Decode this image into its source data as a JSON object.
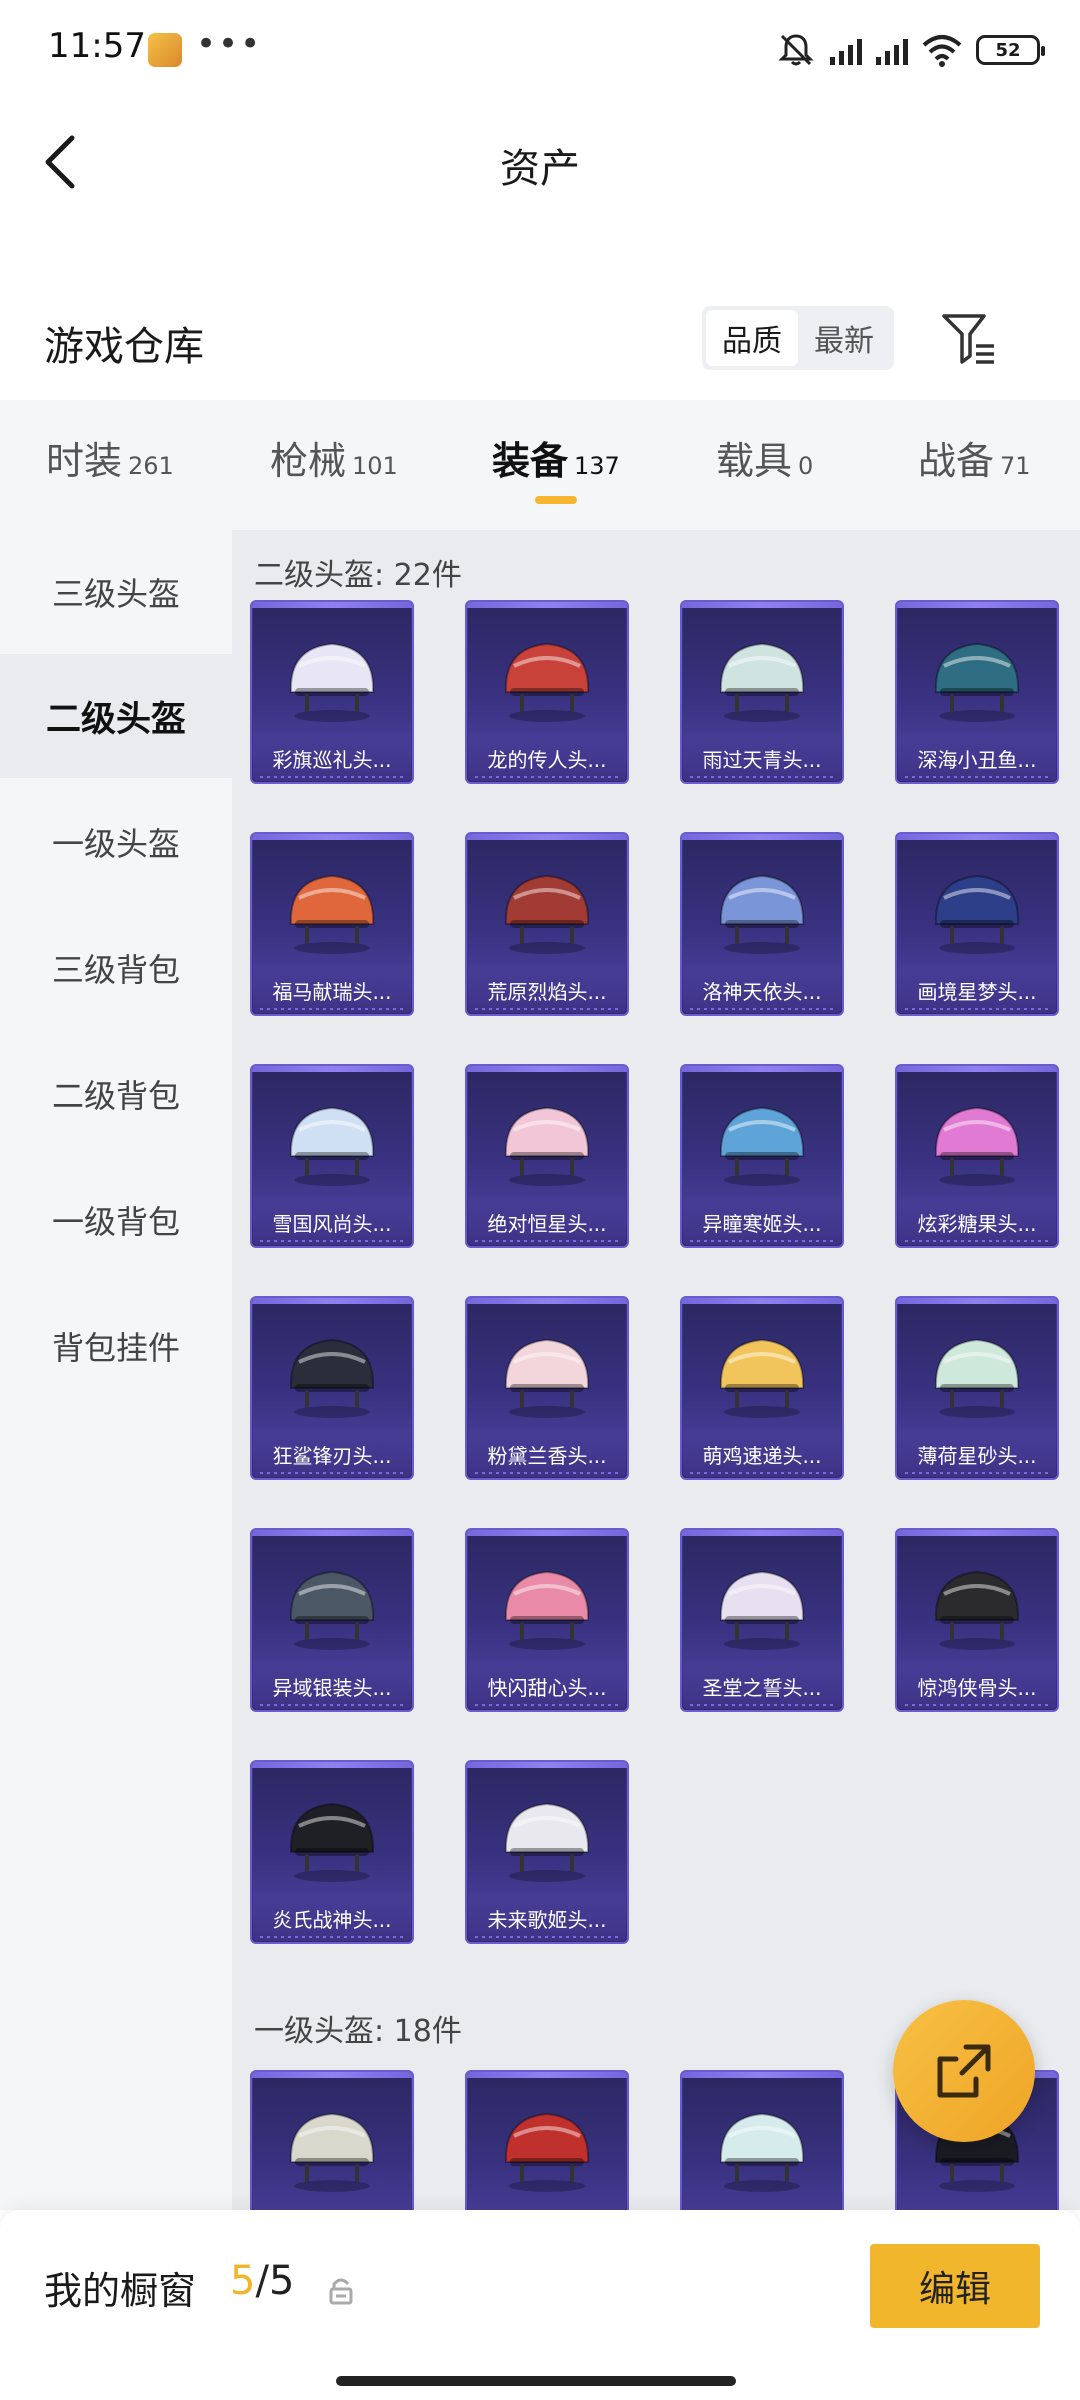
{
  "status_bar": {
    "time": "11:57",
    "dots": "•••",
    "battery": "52"
  },
  "header": {
    "title": "资产"
  },
  "warehouse": {
    "title": "游戏仓库",
    "sort_options": [
      "品质",
      "最新"
    ]
  },
  "tabs": [
    {
      "label": "时装",
      "count": "261"
    },
    {
      "label": "枪械",
      "count": "101"
    },
    {
      "label": "装备",
      "count": "137"
    },
    {
      "label": "载具",
      "count": "0"
    },
    {
      "label": "战备",
      "count": "71"
    }
  ],
  "sidebar": {
    "items": [
      "三级头盔",
      "二级头盔",
      "一级头盔",
      "三级背包",
      "二级背包",
      "一级背包",
      "背包挂件"
    ]
  },
  "sections": [
    {
      "title": "二级头盔: 22件",
      "items": [
        {
          "name": "彩旗巡礼头..."
        },
        {
          "name": "龙的传人头..."
        },
        {
          "name": "雨过天青头..."
        },
        {
          "name": "深海小丑鱼..."
        },
        {
          "name": "福马献瑞头..."
        },
        {
          "name": "荒原烈焰头..."
        },
        {
          "name": "洛神天依头..."
        },
        {
          "name": "画境星梦头..."
        },
        {
          "name": "雪国风尚头..."
        },
        {
          "name": "绝对恒星头..."
        },
        {
          "name": "异瞳寒姬头..."
        },
        {
          "name": "炫彩糖果头..."
        },
        {
          "name": "狂鲨锋刃头..."
        },
        {
          "name": "粉黛兰香头..."
        },
        {
          "name": "萌鸡速递头..."
        },
        {
          "name": "薄荷星砂头..."
        },
        {
          "name": "异域银装头..."
        },
        {
          "name": "快闪甜心头..."
        },
        {
          "name": "圣堂之誓头..."
        },
        {
          "name": "惊鸿侠骨头..."
        },
        {
          "name": "炎氏战神头..."
        },
        {
          "name": "未来歌姬头..."
        }
      ]
    },
    {
      "title": "一级头盔: 18件"
    }
  ],
  "bottom_bar": {
    "label": "我的橱窗",
    "current": "5",
    "separator": "/",
    "total": "5",
    "edit_label": "编辑"
  },
  "helmet_colors": [
    "#e8e6f4",
    "#c8423a",
    "#cfe3e0",
    "#2e6d82",
    "#e0673c",
    "#a23b34",
    "#7a95d8",
    "#2c3f88",
    "#cfe0f4",
    "#f2c6d6",
    "#5fa4d8",
    "#e07ad2",
    "#2a2d3a",
    "#f2d6dc",
    "#f2c55c",
    "#cfe8dc",
    "#4c5766",
    "#e88aa8",
    "#e6e0f0",
    "#2b2b2e",
    "#1f1f26",
    "#e8e8ee",
    "#d8d8cc",
    "#c0302c",
    "#d6ecec",
    "#1b1b22"
  ]
}
